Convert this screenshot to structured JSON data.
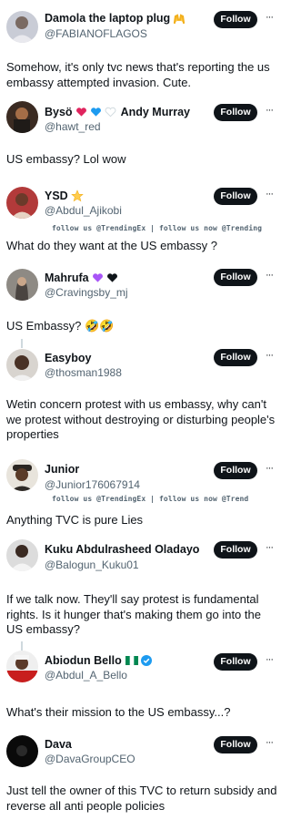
{
  "posts": [
    {
      "name": "Damola the laptop plug",
      "handle": "@FABIANOFLAGOS",
      "follow": "Follow",
      "more": "···",
      "text": "Somehow, it's only tvc news that's reporting the us embassy attempted invasion. Cute.",
      "emoji_after_name": [
        "raising-hands-emoji"
      ]
    },
    {
      "name_prefix": "Bysö",
      "name_suffix": "Andy Murray",
      "handle": "@hawt_red",
      "follow": "Follow",
      "more": "···",
      "text": "US embassy? Lol wow",
      "hearts": [
        "#e0245e",
        "#1d9bf0",
        "#e6ecf0"
      ]
    },
    {
      "name": "YSD",
      "handle": "@Abdul_Ajikobi",
      "follow": "Follow",
      "more": "···",
      "watermark": "follow us @TrendingEx | follow us now @Trending",
      "text": "What do they want at the US embassy ?",
      "emoji_after_name": [
        "star-emoji"
      ]
    },
    {
      "name": "Mahrufa",
      "handle": "@Cravingsby_mj",
      "follow": "Follow",
      "more": "···",
      "text": "US Embassy? 🤣🤣",
      "hearts": [
        "#a855f7",
        "#0f1419"
      ]
    },
    {
      "name": "Easyboy",
      "handle": "@thosman1988",
      "follow": "Follow",
      "more": "···",
      "text": "Wetin concern protest with us embassy, why can't we protest without destroying or disturbing people's properties"
    },
    {
      "name": "Junior",
      "handle": "@Junior176067914",
      "follow": "Follow",
      "more": "···",
      "watermark": "follow us @TrendingEx | follow us now @Trend",
      "text": "Anything TVC is pure Lies"
    },
    {
      "name": "Kuku Abdulrasheed Oladayo",
      "handle": "@Balogun_Kuku01",
      "follow": "Follow",
      "more": "···",
      "text": "If we talk now. They'll say protest is fundamental rights. Is it hunger that's making them go into the US embassy?"
    },
    {
      "name": "Abiodun Bello",
      "handle": "@Abdul_A_Bello",
      "follow": "Follow",
      "more": "···",
      "text": "What's their mission to the US embassy...?"
    },
    {
      "name": "Dava",
      "handle": "@DavaGroupCEO",
      "follow": "Follow",
      "more": "···",
      "text": "Just tell the owner of this TVC to return subsidy and reverse all anti people policies"
    }
  ],
  "colors": {
    "text": "#0f1419",
    "secondary": "#536471",
    "follow_bg": "#0f1419",
    "follow_fg": "#ffffff",
    "verified": "#1d9bf0",
    "flag_green": "#008751"
  }
}
